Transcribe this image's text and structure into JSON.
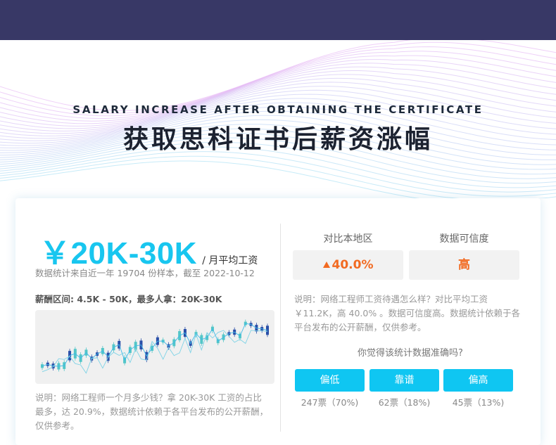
{
  "header": {
    "title_en": "SALARY INCREASE AFTER OBTAINING THE CERTIFICATE",
    "title_cn": "获取思科证书后薪资涨幅"
  },
  "salary": {
    "value": "￥20K-30K",
    "unit": "/ 月平均工资",
    "stat_note": "数据统计来自近一年 19704 份样本，截至 2022-10-12",
    "range_line": "薪酬区间: 4.5K - 50K，最多人拿：20K-30K",
    "description": "说明：网络工程师一个月多少钱？拿 20K-30K 工资的占比最多，达 20.9%，数据统计依赖于各平台发布的公开薪酬，仅供参考。"
  },
  "comparison": {
    "region_label": "对比本地区",
    "region_value": "40.0%",
    "region_trend": "up",
    "credibility_label": "数据可信度",
    "credibility_value": "高",
    "description": "说明：网络工程师工资待遇怎么样？对比平均工资 ￥11.2K，高 40.0% 。数据可信度高。数据统计依赖于各平台发布的公开薪酬，仅供参考。"
  },
  "poll": {
    "question": "你觉得该统计数据准确吗?",
    "options": [
      {
        "label": "偏低",
        "count": "247票（70%)"
      },
      {
        "label": "靠谱",
        "count": "62票（18%)"
      },
      {
        "label": "偏高",
        "count": "45票（13%)"
      }
    ]
  },
  "colors": {
    "topbar": "#383866",
    "accent": "#18c6ef",
    "button": "#0fc6f2",
    "highlight": "#f26a21",
    "chart_bg": "#f0f0f0"
  }
}
